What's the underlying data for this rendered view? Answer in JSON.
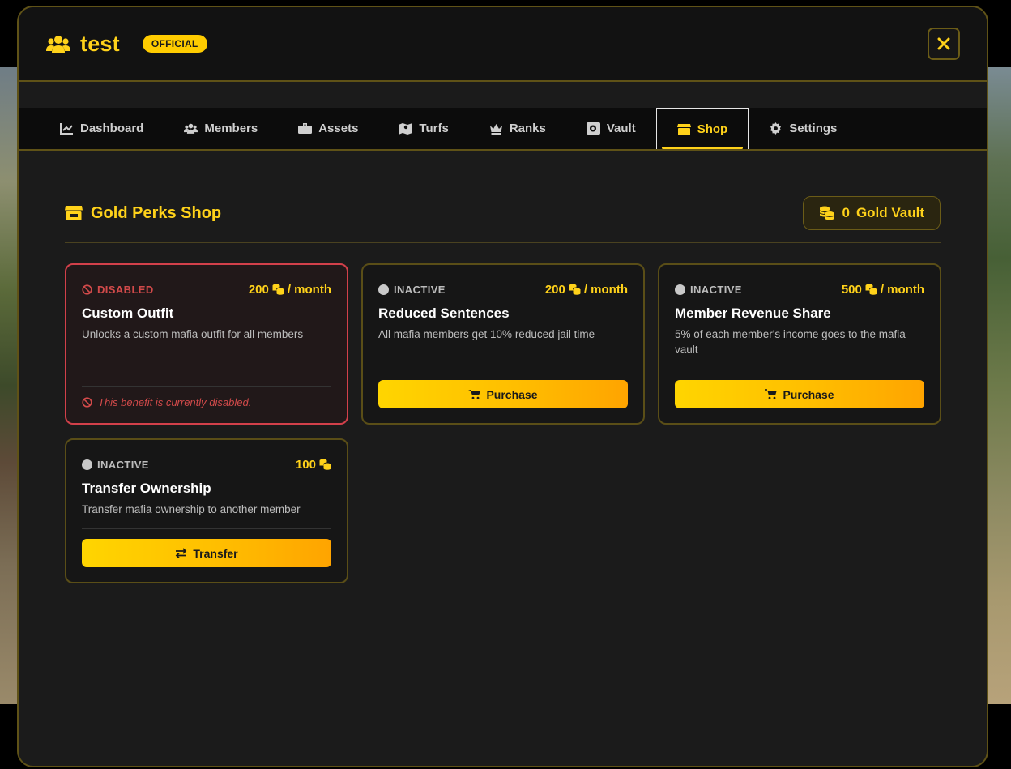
{
  "header": {
    "title": "test",
    "badge": "OFFICIAL"
  },
  "tabs": [
    {
      "label": "Dashboard",
      "icon": "chart-line-icon"
    },
    {
      "label": "Members",
      "icon": "users-icon"
    },
    {
      "label": "Assets",
      "icon": "briefcase-icon"
    },
    {
      "label": "Turfs",
      "icon": "map-icon"
    },
    {
      "label": "Ranks",
      "icon": "crown-icon"
    },
    {
      "label": "Vault",
      "icon": "vault-icon"
    },
    {
      "label": "Shop",
      "icon": "store-icon",
      "active": true
    },
    {
      "label": "Settings",
      "icon": "gear-icon"
    }
  ],
  "shop": {
    "title": "Gold Perks Shop",
    "vault_amount": "0",
    "vault_label": "Gold Vault"
  },
  "perks": [
    {
      "status": "DISABLED",
      "price": "200",
      "period": "/ month",
      "name": "Custom Outfit",
      "description": "Unlocks a custom mafia outfit for all members",
      "note": "This benefit is currently disabled."
    },
    {
      "status": "INACTIVE",
      "price": "200",
      "period": "/ month",
      "name": "Reduced Sentences",
      "description": "All mafia members get 10% reduced jail time",
      "action": "Purchase"
    },
    {
      "status": "INACTIVE",
      "price": "500",
      "period": "/ month",
      "name": "Member Revenue Share",
      "description": "5% of each member's income goes to the mafia vault",
      "action": "Purchase"
    },
    {
      "status": "INACTIVE",
      "price": "100",
      "period": "",
      "name": "Transfer Ownership",
      "description": "Transfer mafia ownership to another member",
      "action": "Transfer"
    }
  ],
  "colors": {
    "accent": "#ffd21a",
    "disabled": "#d24a4a",
    "border": "#5f5217"
  }
}
